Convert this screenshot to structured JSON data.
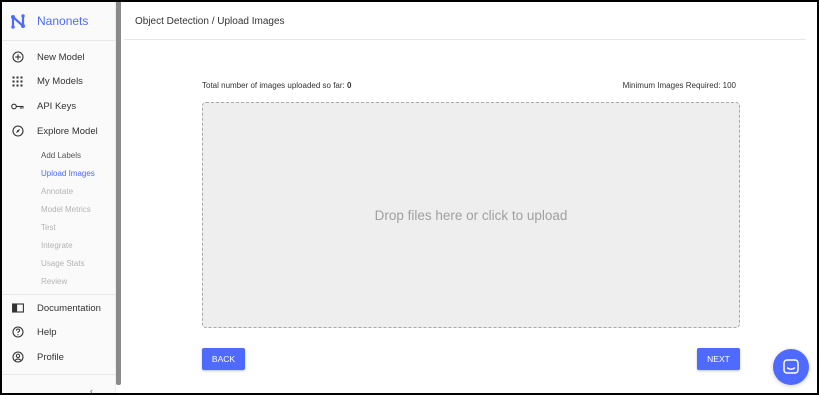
{
  "app": {
    "brand": "Nanonets"
  },
  "colors": {
    "accent": "#4f6bff",
    "dropzone_bg": "#eeeeee",
    "sidebar_bg": "#fafafa"
  },
  "sidebar": {
    "nav": [
      {
        "label": "New Model",
        "icon": "plus-circle-icon"
      },
      {
        "label": "My Models",
        "icon": "grid-icon"
      },
      {
        "label": "API Keys",
        "icon": "key-icon"
      },
      {
        "label": "Explore Model",
        "icon": "compass-icon"
      }
    ],
    "sub_items": [
      {
        "label": "Add Labels",
        "state": "done"
      },
      {
        "label": "Upload Images",
        "state": "active"
      },
      {
        "label": "Annotate",
        "state": "disabled"
      },
      {
        "label": "Model Metrics",
        "state": "disabled"
      },
      {
        "label": "Test",
        "state": "disabled"
      },
      {
        "label": "Integrate",
        "state": "disabled"
      },
      {
        "label": "Usage Stats",
        "state": "disabled"
      },
      {
        "label": "Review",
        "state": "disabled"
      }
    ],
    "bottom_nav": [
      {
        "label": "Documentation",
        "icon": "book-icon"
      },
      {
        "label": "Help",
        "icon": "help-circle-icon"
      },
      {
        "label": "Profile",
        "icon": "user-circle-icon"
      }
    ],
    "collapse_icon": "chevron-left-icon"
  },
  "header": {
    "breadcrumb": "Object Detection / Upload Images"
  },
  "upload": {
    "count_label": "Total number of images uploaded so far: ",
    "count_value": "0",
    "min_label": "Minimum Images Required: 100",
    "drop_text": "Drop files here or click to upload"
  },
  "buttons": {
    "back": "BACK",
    "next": "NEXT"
  },
  "chat": {
    "icon": "chat-icon"
  }
}
